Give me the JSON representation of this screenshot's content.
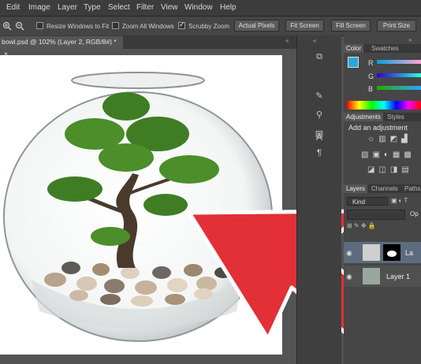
{
  "menu": [
    "Edit",
    "Image",
    "Layer",
    "Type",
    "Select",
    "Filter",
    "View",
    "Window",
    "Help"
  ],
  "options": {
    "resize_label": "Resize Windows to Fit",
    "zoom_all_label": "Zoom All Windows",
    "scrubby_label": "Scrubby Zoom",
    "buttons": [
      "Actual Pixels",
      "Fit Screen",
      "Fill Screen",
      "Print Size"
    ]
  },
  "document": {
    "tab_title": "bowl.psd @ 102% (Layer 2, RGB/8#) *",
    "close": "×"
  },
  "panels": {
    "color_tabs": [
      "Color",
      "Swatches"
    ],
    "channels": [
      "R",
      "G",
      "B"
    ],
    "adjustments_tabs": [
      "Adjustments",
      "Styles"
    ],
    "add_adjustment": "Add an adjustment",
    "layers_tabs": [
      "Layers",
      "Channels",
      "Paths"
    ],
    "kind_label": "Kind",
    "op_label": "Op",
    "layer_names": [
      "La",
      "Layer 1"
    ]
  },
  "colors": {
    "arrow": "#e32f36",
    "fg_swatch": "#2aa7dc"
  }
}
